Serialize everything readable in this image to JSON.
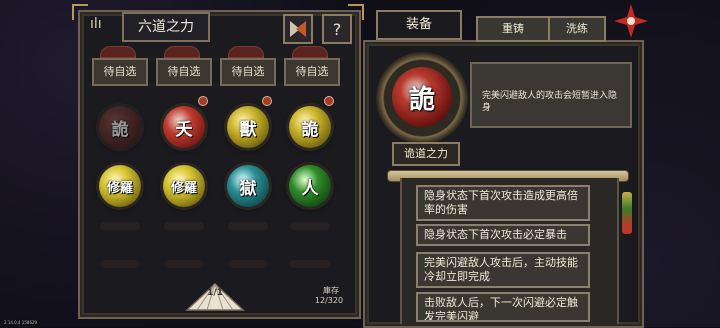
{
  "left_panel": {
    "title": "六道之力",
    "slots": [
      "待自选",
      "待自选",
      "待自选",
      "待自选"
    ],
    "orbs": [
      {
        "glyph": "詭",
        "color": "#5b1f1c",
        "dim": true
      },
      {
        "glyph": "夭",
        "color": "#c13a2e",
        "dim": false
      },
      {
        "glyph": "獸",
        "color": "#c8b22a",
        "dim": false
      },
      {
        "glyph": "詭",
        "color": "#c8b22a",
        "dim": false
      },
      {
        "glyph": "修羅",
        "color": "#d4c22e",
        "dim": false
      },
      {
        "glyph": "修羅",
        "color": "#d4c22e",
        "dim": false
      },
      {
        "glyph": "獄",
        "color": "#2a8f93",
        "dim": false
      },
      {
        "glyph": "人",
        "color": "#2f8c2a",
        "dim": false
      }
    ],
    "fan_label": "1/1",
    "stock_label": "庫存",
    "stock_value": "12/320",
    "help_glyph": "?"
  },
  "right_panel": {
    "tabs": [
      "装备",
      "重铸",
      "洗练"
    ],
    "active_tab": "装备",
    "skill_glyph": "詭",
    "skill_name": "诡道之力",
    "skill_desc": "完美闪避敌人的攻击会短暂进入隐身",
    "effects": [
      "隐身状态下首次攻击造成更高倍率的伤害",
      "隐身状态下首次攻击必定暴击",
      "完美闪避敌人攻击后，主动技能冷却立即完成",
      "击败敌人后，下一次闪避必定触发完美闪避"
    ]
  },
  "version": "2.14.0.4 158629"
}
